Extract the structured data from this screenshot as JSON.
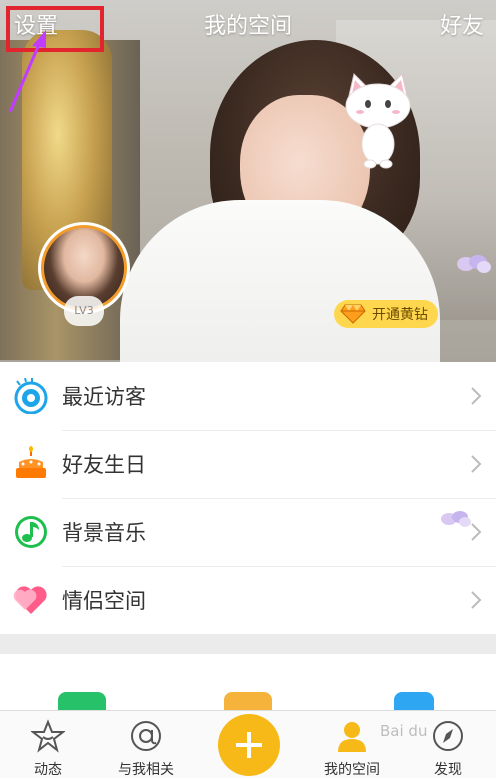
{
  "header": {
    "left_label": "设置",
    "title": "我的空间",
    "right_label": "好友"
  },
  "profile": {
    "level": "LV3",
    "vip_button": "开通黄钻"
  },
  "menu": {
    "items": [
      {
        "label": "最近访客",
        "icon": "eye-icon"
      },
      {
        "label": "好友生日",
        "icon": "cake-icon"
      },
      {
        "label": "背景音乐",
        "icon": "music-note-icon"
      },
      {
        "label": "情侣空间",
        "icon": "heart-icon"
      }
    ]
  },
  "tabbar": {
    "items": [
      {
        "label": "动态",
        "icon": "star-icon"
      },
      {
        "label": "与我相关",
        "icon": "at-icon"
      },
      {
        "label": "我的空间",
        "icon": "person-icon"
      },
      {
        "label": "发现",
        "icon": "compass-icon"
      }
    ],
    "plus_icon": "plus-icon"
  },
  "colors": {
    "accent": "#f7b917",
    "highlight": "#e2242e",
    "annotation_arrow": "#c13cff"
  },
  "watermark": "Bai du"
}
